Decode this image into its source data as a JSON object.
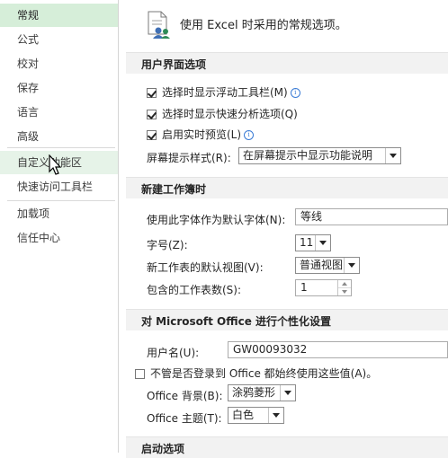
{
  "sidebar": {
    "items": [
      {
        "label": "常规",
        "selected": true
      },
      {
        "label": "公式"
      },
      {
        "label": "校对"
      },
      {
        "label": "保存"
      },
      {
        "label": "语言"
      },
      {
        "label": "高级"
      },
      {
        "label": "自定义功能区",
        "hover": true
      },
      {
        "label": "快速访问工具栏"
      },
      {
        "label": "加载项"
      },
      {
        "label": "信任中心"
      }
    ]
  },
  "main": {
    "intro": "使用 Excel 时采用的常规选项。",
    "intro_icon": "general-options-icon",
    "sections": {
      "ui": {
        "title": "用户界面选项",
        "mini_toolbar": "选择时显示浮动工具栏(M)",
        "quick_analysis": "选择时显示快速分析选项(Q)",
        "live_preview": "启用实时预览(L)",
        "screentip_label": "屏幕提示样式(R):",
        "screentip_value": "在屏幕提示中显示功能说明"
      },
      "new_workbook": {
        "title": "新建工作簿时",
        "font_label": "使用此字体作为默认字体(N):",
        "font_value": "等线",
        "size_label": "字号(Z):",
        "size_value": "11",
        "view_label": "新工作表的默认视图(V):",
        "view_value": "普通视图",
        "sheets_label": "包含的工作表数(S):",
        "sheets_value": "1"
      },
      "personalize": {
        "title": "对 Microsoft Office 进行个性化设置",
        "username_label": "用户名(U):",
        "username_value": "GW00093032",
        "always_use_label": "不管是否登录到 Office 都始终使用这些值(A)。",
        "background_label": "Office 背景(B):",
        "background_value": "涂鸦菱形",
        "theme_label": "Office 主题(T):",
        "theme_value": "白色"
      },
      "startup": {
        "title": "启动选项"
      }
    }
  },
  "colors": {
    "selected_nav": "#d6eed9",
    "section_bg": "#f2f2f2"
  }
}
